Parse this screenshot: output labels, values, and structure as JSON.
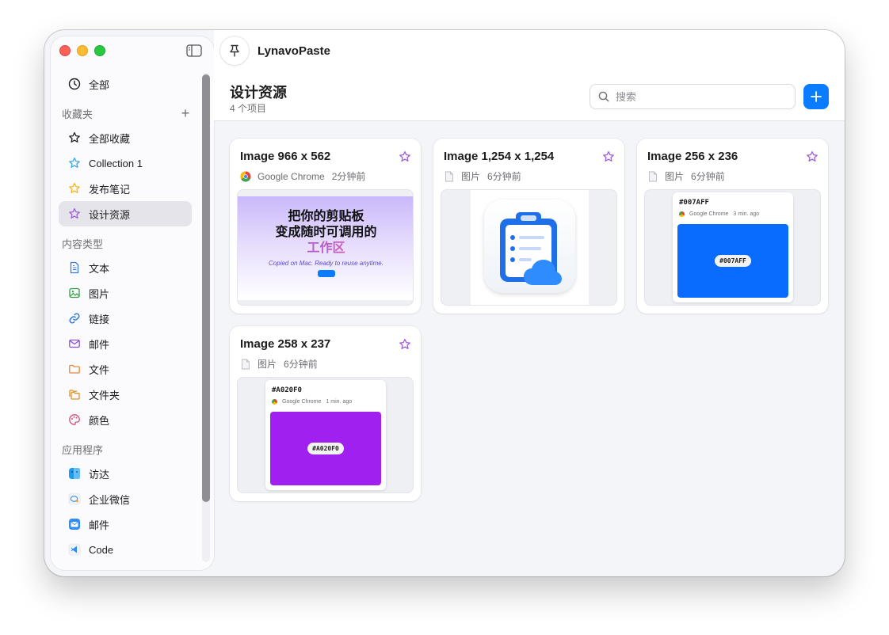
{
  "app": {
    "title": "LynavoPaste"
  },
  "sidebar": {
    "all": {
      "label": "全部",
      "icon": "clock-icon"
    },
    "favorites": {
      "header": "收藏夹",
      "add_icon": "plus-icon",
      "items": [
        {
          "label": "全部收藏",
          "icon": "star-icon",
          "color": "#1d1d1f"
        },
        {
          "label": "Collection 1",
          "icon": "star-icon",
          "color": "#3aa6e8"
        },
        {
          "label": "发布笔记",
          "icon": "star-icon",
          "color": "#f2b51c"
        },
        {
          "label": "设计资源",
          "icon": "star-icon",
          "color": "#a05cd8",
          "active": true
        }
      ]
    },
    "content_types": {
      "header": "内容类型",
      "items": [
        {
          "label": "文本",
          "icon": "document-icon",
          "color": "#3b7ddd"
        },
        {
          "label": "图片",
          "icon": "photo-icon",
          "color": "#2f9e44"
        },
        {
          "label": "链接",
          "icon": "link-icon",
          "color": "#1f6fe0"
        },
        {
          "label": "邮件",
          "icon": "envelope-icon",
          "color": "#8a4fd6"
        },
        {
          "label": "文件",
          "icon": "folder-icon",
          "color": "#e8873a"
        },
        {
          "label": "文件夹",
          "icon": "folders-icon",
          "color": "#e0902a"
        },
        {
          "label": "颜色",
          "icon": "palette-icon",
          "color": "#d64b7a"
        }
      ]
    },
    "apps": {
      "header": "应用程序",
      "items": [
        {
          "label": "访达",
          "icon": "finder-icon"
        },
        {
          "label": "企业微信",
          "icon": "wecom-icon"
        },
        {
          "label": "邮件",
          "icon": "mail-app-icon"
        },
        {
          "label": "Code",
          "icon": "vscode-icon"
        }
      ]
    }
  },
  "header": {
    "page_title": "设计资源",
    "item_count": "4 个项目",
    "search_placeholder": "搜索"
  },
  "cards": [
    {
      "title": "Image 966 x 562",
      "source": "Google Chrome",
      "time": "2分钟前",
      "source_icon": "chrome-icon",
      "preview": {
        "line1": "把你的剪贴板",
        "line2": "变成随时可调用的",
        "line3": "工作区",
        "tagline": "Copied on Mac. Ready to reuse anytime."
      }
    },
    {
      "title": "Image 1,254 x 1,254",
      "source": "图片",
      "time": "6分钟前",
      "source_icon": "file-icon"
    },
    {
      "title": "Image 256 x 236",
      "source": "图片",
      "time": "6分钟前",
      "source_icon": "file-icon",
      "preview": {
        "hex": "#007AFF",
        "app": "Google Chrome",
        "ago": "3 min. ago",
        "pill": "#007AFF",
        "color": "#0a6cff"
      }
    },
    {
      "title": "Image 258 x 237",
      "source": "图片",
      "time": "6分钟前",
      "source_icon": "file-icon",
      "preview": {
        "hex": "#A020F0",
        "app": "Google Chrome",
        "ago": "1 min. ago",
        "pill": "#A020F0",
        "color": "#a020f0"
      }
    }
  ],
  "colors": {
    "accent": "#0a7cff",
    "favorite_star": "#a05cd8"
  }
}
